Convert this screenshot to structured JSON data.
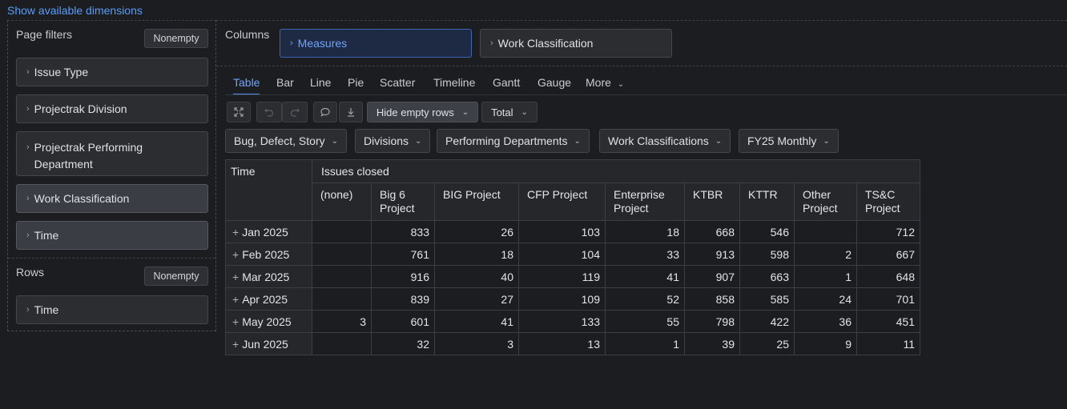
{
  "show_dims": "Show available dimensions",
  "page_filters": {
    "label": "Page filters",
    "nonempty": "Nonempty",
    "items": [
      "Issue Type",
      "Projectrak Division",
      "Projectrak Performing Department",
      "Work Classification",
      "Time"
    ]
  },
  "rows": {
    "label": "Rows",
    "nonempty": "Nonempty",
    "items": [
      "Time"
    ]
  },
  "columns": {
    "label": "Columns",
    "items": [
      "Measures",
      "Work Classification"
    ]
  },
  "tabs": [
    "Table",
    "Bar",
    "Line",
    "Pie",
    "Scatter",
    "Timeline",
    "Gantt",
    "Gauge",
    "More"
  ],
  "toolbar": {
    "hide_empty": "Hide empty rows",
    "total": "Total"
  },
  "filters": [
    "Bug, Defect, Story",
    "Divisions",
    "Performing Departments",
    "Work Classifications",
    "FY25 Monthly"
  ],
  "table": {
    "corner": "Time",
    "measure": "Issues closed",
    "columns": [
      "(none)",
      "Big 6 Project",
      "BIG Project",
      "CFP Project",
      "Enterprise Project",
      "KTBR",
      "KTTR",
      "Other Project",
      "TS&C Project"
    ],
    "rows": [
      {
        "label": "Jan 2025",
        "values": [
          "",
          "833",
          "26",
          "103",
          "18",
          "668",
          "546",
          "",
          "712"
        ]
      },
      {
        "label": "Feb 2025",
        "values": [
          "",
          "761",
          "18",
          "104",
          "33",
          "913",
          "598",
          "2",
          "667"
        ]
      },
      {
        "label": "Mar 2025",
        "values": [
          "",
          "916",
          "40",
          "119",
          "41",
          "907",
          "663",
          "1",
          "648"
        ]
      },
      {
        "label": "Apr 2025",
        "values": [
          "",
          "839",
          "27",
          "109",
          "52",
          "858",
          "585",
          "24",
          "701"
        ]
      },
      {
        "label": "May 2025",
        "values": [
          "3",
          "601",
          "41",
          "133",
          "55",
          "798",
          "422",
          "36",
          "451"
        ]
      },
      {
        "label": "Jun 2025",
        "values": [
          "",
          "32",
          "3",
          "13",
          "1",
          "39",
          "25",
          "9",
          "11"
        ]
      }
    ]
  }
}
